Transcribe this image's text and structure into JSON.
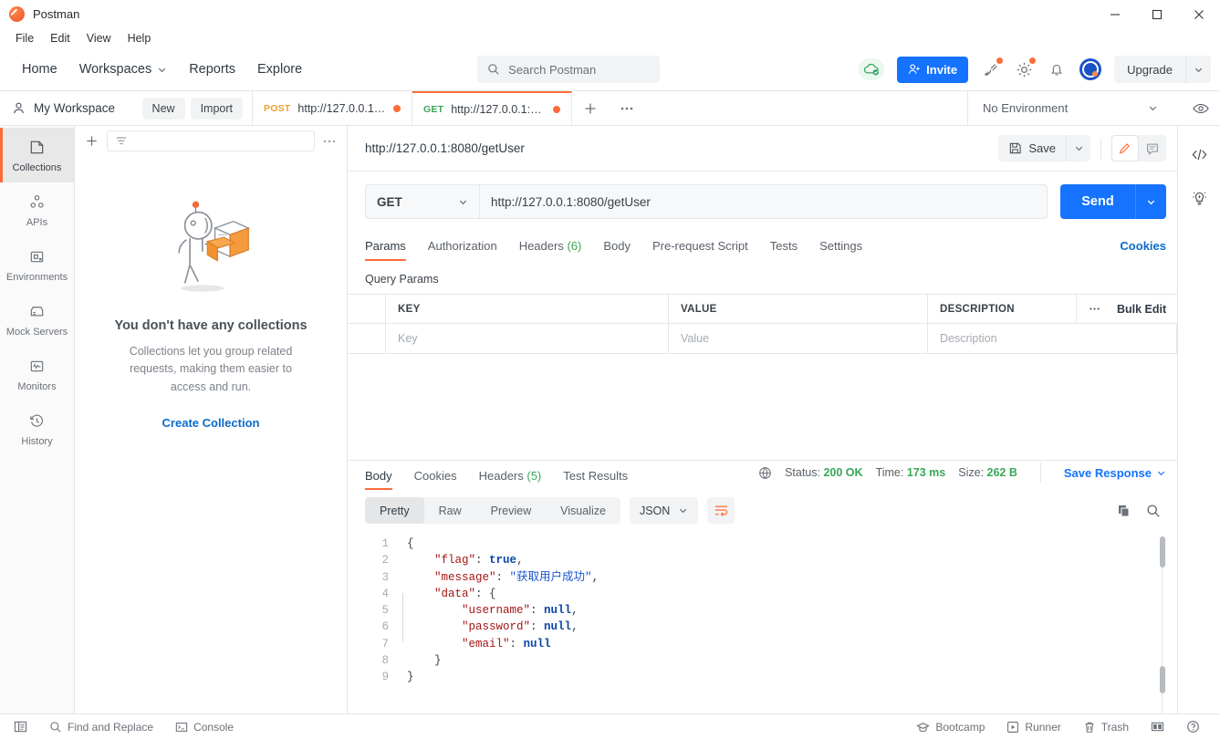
{
  "window": {
    "title": "Postman",
    "controls": {
      "minimize": "minimize-icon",
      "maximize": "maximize-icon",
      "close": "close-icon"
    }
  },
  "menubar": {
    "items": [
      "File",
      "Edit",
      "View",
      "Help"
    ]
  },
  "header": {
    "nav": [
      {
        "label": "Home",
        "has_caret": false
      },
      {
        "label": "Workspaces",
        "has_caret": true
      },
      {
        "label": "Reports",
        "has_caret": false
      },
      {
        "label": "Explore",
        "has_caret": false
      }
    ],
    "search": {
      "placeholder": "Search Postman",
      "icon": "search-icon"
    },
    "invite_label": "Invite",
    "upgrade_label": "Upgrade",
    "icons": [
      "cloud-check-icon",
      "satellite-icon",
      "gear-icon",
      "bell-icon",
      "avatar-icon"
    ]
  },
  "workspace_bar": {
    "name": "My Workspace",
    "new_label": "New",
    "import_label": "Import",
    "environment": {
      "selected": "No Environment",
      "eye_icon": "eye-icon"
    }
  },
  "request_tabs": [
    {
      "method": "POST",
      "url": "http://127.0.0.1:8...",
      "unsaved": true,
      "active": false
    },
    {
      "method": "GET",
      "url": "http://127.0.0.1:80...",
      "unsaved": true,
      "active": true
    }
  ],
  "sidebar": {
    "items": [
      {
        "label": "Collections",
        "icon": "collections-icon",
        "active": true
      },
      {
        "label": "APIs",
        "icon": "apis-icon",
        "active": false
      },
      {
        "label": "Environments",
        "icon": "environments-icon",
        "active": false
      },
      {
        "label": "Mock Servers",
        "icon": "mock-servers-icon",
        "active": false
      },
      {
        "label": "Monitors",
        "icon": "monitors-icon",
        "active": false
      },
      {
        "label": "History",
        "icon": "history-icon",
        "active": false
      }
    ]
  },
  "collections_panel": {
    "filter_placeholder": "",
    "empty_title": "You don't have any collections",
    "empty_desc": "Collections let you group related requests, making them easier to access and run.",
    "create_link": "Create Collection"
  },
  "request": {
    "title": "http://127.0.0.1:8080/getUser",
    "save_label": "Save",
    "method": "GET",
    "url": "http://127.0.0.1:8080/getUser",
    "send_label": "Send",
    "tabs": [
      {
        "label": "Params",
        "active": true
      },
      {
        "label": "Authorization",
        "active": false
      },
      {
        "label": "Headers",
        "count": "(6)",
        "active": false
      },
      {
        "label": "Body",
        "active": false
      },
      {
        "label": "Pre-request Script",
        "active": false
      },
      {
        "label": "Tests",
        "active": false
      },
      {
        "label": "Settings",
        "active": false
      }
    ],
    "cookies_link": "Cookies",
    "query_params_label": "Query Params",
    "params_table": {
      "headers": [
        "KEY",
        "VALUE",
        "DESCRIPTION"
      ],
      "bulk_edit_label": "Bulk Edit",
      "rows": [
        {
          "key": "Key",
          "value": "Value",
          "description": "Description"
        }
      ]
    }
  },
  "response": {
    "tabs": [
      {
        "label": "Body",
        "active": true
      },
      {
        "label": "Cookies",
        "active": false
      },
      {
        "label": "Headers",
        "count": "(5)",
        "active": false
      },
      {
        "label": "Test Results",
        "active": false
      }
    ],
    "status_label": "Status:",
    "status_value": "200 OK",
    "time_label": "Time:",
    "time_value": "173 ms",
    "size_label": "Size:",
    "size_value": "262 B",
    "save_response_label": "Save Response",
    "view_pills": [
      "Pretty",
      "Raw",
      "Preview",
      "Visualize"
    ],
    "active_pill": "Pretty",
    "format": "JSON",
    "line_numbers": [
      "1",
      "2",
      "3",
      "4",
      "5",
      "6",
      "7",
      "8",
      "9"
    ],
    "body_lines": [
      [
        {
          "t": "{",
          "c": "punct"
        }
      ],
      [
        {
          "t": "    ",
          "c": "punct"
        },
        {
          "t": "\"flag\"",
          "c": "key"
        },
        {
          "t": ": ",
          "c": "punct"
        },
        {
          "t": "true",
          "c": "bool"
        },
        {
          "t": ",",
          "c": "punct"
        }
      ],
      [
        {
          "t": "    ",
          "c": "punct"
        },
        {
          "t": "\"message\"",
          "c": "key"
        },
        {
          "t": ": ",
          "c": "punct"
        },
        {
          "t": "\"获取用户成功\"",
          "c": "str"
        },
        {
          "t": ",",
          "c": "punct"
        }
      ],
      [
        {
          "t": "    ",
          "c": "punct"
        },
        {
          "t": "\"data\"",
          "c": "key"
        },
        {
          "t": ": ",
          "c": "punct"
        },
        {
          "t": "{",
          "c": "punct"
        }
      ],
      [
        {
          "t": "        ",
          "c": "punct"
        },
        {
          "t": "\"username\"",
          "c": "key"
        },
        {
          "t": ": ",
          "c": "punct"
        },
        {
          "t": "null",
          "c": "null"
        },
        {
          "t": ",",
          "c": "punct"
        }
      ],
      [
        {
          "t": "        ",
          "c": "punct"
        },
        {
          "t": "\"password\"",
          "c": "key"
        },
        {
          "t": ": ",
          "c": "punct"
        },
        {
          "t": "null",
          "c": "null"
        },
        {
          "t": ",",
          "c": "punct"
        }
      ],
      [
        {
          "t": "        ",
          "c": "punct"
        },
        {
          "t": "\"email\"",
          "c": "key"
        },
        {
          "t": ": ",
          "c": "punct"
        },
        {
          "t": "null",
          "c": "null"
        }
      ],
      [
        {
          "t": "    ",
          "c": "punct"
        },
        {
          "t": "}",
          "c": "punct"
        }
      ],
      [
        {
          "t": "}",
          "c": "punct"
        }
      ]
    ]
  },
  "statusbar": {
    "left": [
      {
        "label": "",
        "icon": "sidebar-toggle-icon"
      },
      {
        "label": "Find and Replace",
        "icon": "search-icon"
      },
      {
        "label": "Console",
        "icon": "console-icon"
      }
    ],
    "right": [
      {
        "label": "Bootcamp",
        "icon": "bootcamp-icon"
      },
      {
        "label": "Runner",
        "icon": "runner-icon"
      },
      {
        "label": "Trash",
        "icon": "trash-icon"
      },
      {
        "label": "",
        "icon": "layout-icon"
      },
      {
        "label": "",
        "icon": "help-icon"
      }
    ]
  },
  "colors": {
    "accent_orange": "#ff6c37",
    "blue": "#1573ff",
    "green": "#3aa757",
    "link": "#0b6bcb"
  }
}
